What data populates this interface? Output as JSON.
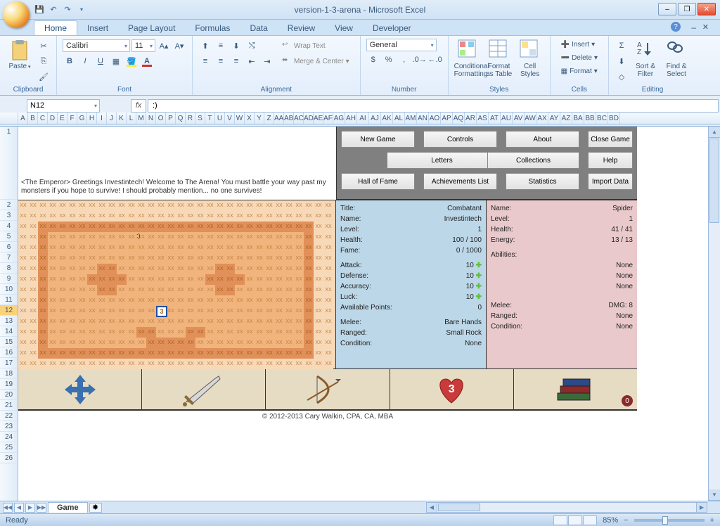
{
  "window": {
    "title": "version-1-3-arena - Microsoft Excel",
    "min": "–",
    "max": "❐",
    "close": "✕"
  },
  "tabs": [
    "Home",
    "Insert",
    "Page Layout",
    "Formulas",
    "Data",
    "Review",
    "View",
    "Developer"
  ],
  "ribbon": {
    "clipboard": {
      "paste": "Paste",
      "label": "Clipboard"
    },
    "font": {
      "name": "Calibri",
      "size": "11",
      "label": "Font"
    },
    "alignment": {
      "wrap": "Wrap Text",
      "merge": "Merge & Center",
      "label": "Alignment"
    },
    "number": {
      "format": "General",
      "label": "Number"
    },
    "styles": {
      "cond": "Conditional Formatting",
      "table": "Format as Table",
      "cell": "Cell Styles",
      "label": "Styles"
    },
    "cells": {
      "insert": "Insert",
      "delete": "Delete",
      "format": "Format",
      "label": "Cells"
    },
    "editing": {
      "sort": "Sort & Filter",
      "find": "Find & Select",
      "label": "Editing"
    }
  },
  "namebox": "N12",
  "formula": ":)",
  "column_letters": [
    "A",
    "B",
    "C",
    "D",
    "E",
    "F",
    "G",
    "H",
    "I",
    "J",
    "K",
    "L",
    "M",
    "N",
    "O",
    "P",
    "Q",
    "R",
    "S",
    "T",
    "U",
    "V",
    "W",
    "X",
    "Y",
    "Z",
    "AA",
    "AB",
    "AC",
    "AD",
    "AE",
    "AF",
    "AG",
    "AH",
    "AI",
    "AJ",
    "AK",
    "AL",
    "AM",
    "AN",
    "AO",
    "AP",
    "AQ",
    "AR",
    "AS",
    "AT",
    "AU",
    "AV",
    "AW",
    "AX",
    "AY",
    "AZ",
    "BA",
    "BB",
    "BC",
    "BD"
  ],
  "row_numbers": [
    "1",
    "2",
    "3",
    "4",
    "5",
    "6",
    "7",
    "8",
    "9",
    "10",
    "11",
    "12",
    "13",
    "14",
    "15",
    "16",
    "17",
    "18",
    "19",
    "20",
    "21",
    "22",
    "23",
    "24",
    "25",
    "26"
  ],
  "intro_text": "<The Emperor> Greetings Investintech! Welcome to The Arena! You must battle your way past my monsters if you hope to survive! I should probably mention... no one survives!",
  "buttons": {
    "new_game": "New Game",
    "controls": "Controls",
    "about": "About",
    "close_game": "Close Game",
    "letters": "Letters",
    "collections": "Collections",
    "help": "Help",
    "hof": "Hall of Fame",
    "achievements": "Achievements List",
    "statistics": "Statistics",
    "import": "Import Data"
  },
  "player": {
    "title_lbl": "Title:",
    "title": "Combatant",
    "name_lbl": "Name:",
    "name": "Investintech",
    "level_lbl": "Level:",
    "level": "1",
    "health_lbl": "Health:",
    "health": "100  /  100",
    "fame_lbl": "Fame:",
    "fame": "0  /  1000",
    "attack_lbl": "Attack:",
    "attack": "10",
    "defense_lbl": "Defense:",
    "defense": "10",
    "accuracy_lbl": "Accuracy:",
    "accuracy": "10",
    "luck_lbl": "Luck:",
    "luck": "10",
    "ap_lbl": "Available Points:",
    "ap": "0",
    "melee_lbl": "Melee:",
    "melee": "Bare Hands",
    "ranged_lbl": "Ranged:",
    "ranged": "Small Rock",
    "cond_lbl": "Condition:",
    "cond": "None"
  },
  "enemy": {
    "name_lbl": "Name:",
    "name": "Spider",
    "level_lbl": "Level:",
    "level": "1",
    "health_lbl": "Health:",
    "health": "41  /  41",
    "energy_lbl": "Energy:",
    "energy": "13  /  13",
    "abilities_lbl": "Abilities:",
    "ab1": "None",
    "ab2": "None",
    "ab3": "None",
    "melee_lbl": "Melee:",
    "melee": "DMG: 8",
    "ranged_lbl": "Ranged:",
    "ranged": "None",
    "cond_lbl": "Condition:",
    "cond": "None"
  },
  "player_token": "3",
  "heart_count": "3",
  "book_badge": "0",
  "credit": "© 2012-2013 Cary Walkin, CPA, CA, MBA",
  "sheet_tab": "Game",
  "status": "Ready",
  "zoom": "85%"
}
